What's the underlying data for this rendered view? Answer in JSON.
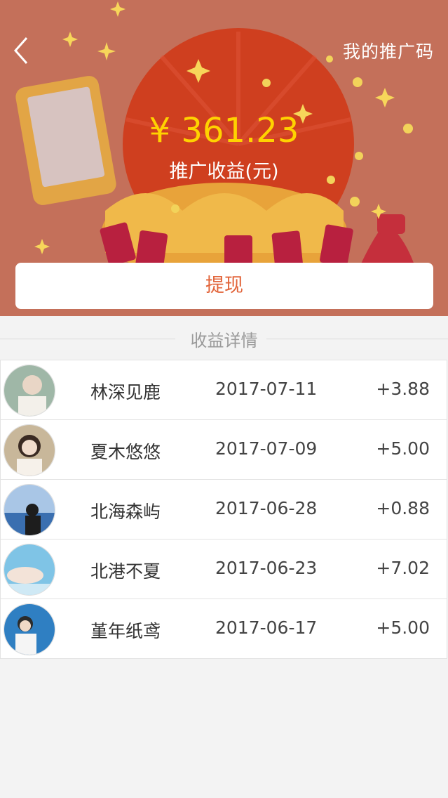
{
  "header": {
    "back_icon": "chevron-left-icon",
    "promo_code_label": "我的推广码"
  },
  "earnings": {
    "amount": "¥ 361.23",
    "label": "推广收益(元)"
  },
  "withdraw_label": "提现",
  "section_title": "收益详情",
  "colors": {
    "hero_bg": "#c4705a",
    "amount": "#ffd200",
    "accent": "#e2643a"
  },
  "records": [
    {
      "name": "林深见鹿",
      "date": "2017-07-11",
      "amount": "+3.88"
    },
    {
      "name": "夏木悠悠",
      "date": "2017-07-09",
      "amount": "+5.00"
    },
    {
      "name": "北海森屿",
      "date": "2017-06-28",
      "amount": "+0.88"
    },
    {
      "name": "北港不夏",
      "date": "2017-06-23",
      "amount": "+7.02"
    },
    {
      "name": "堇年纸鸢",
      "date": "2017-06-17",
      "amount": "+5.00"
    }
  ]
}
